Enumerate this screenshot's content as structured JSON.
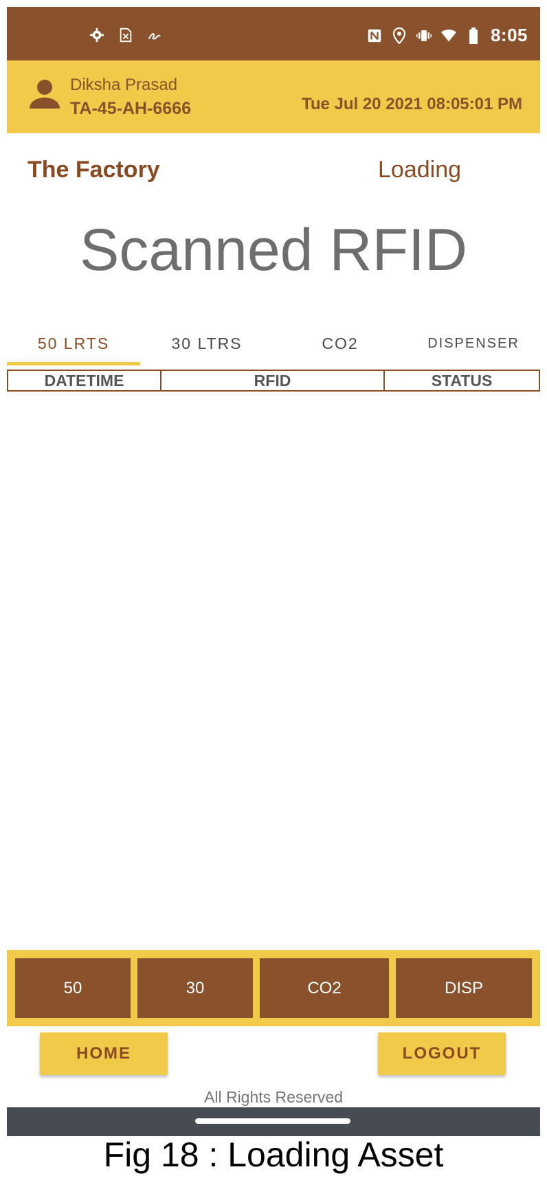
{
  "status_bar": {
    "time": "8:05",
    "left_icons": [
      "settings-icon",
      "sim-card-icon",
      "signature-icon"
    ],
    "right_icons": [
      "nfc-icon",
      "location-icon",
      "vibrate-icon",
      "wifi-icon",
      "battery-icon"
    ]
  },
  "user": {
    "name": "Diksha Prasad",
    "id": "TA-45-AH-6666",
    "datetime": "Tue Jul 20 2021 08:05:01 PM"
  },
  "location": {
    "name": "The Factory",
    "mode": "Loading"
  },
  "heading": "Scanned RFID",
  "tabs": [
    {
      "label": "50 LRTS",
      "active": true
    },
    {
      "label": "30 LTRS",
      "active": false
    },
    {
      "label": "CO2",
      "active": false
    },
    {
      "label": "DISPENSER",
      "active": false
    }
  ],
  "table": {
    "columns": [
      "DATETIME",
      "RFID",
      "STATUS"
    ],
    "rows": []
  },
  "bottom_buttons": [
    "50",
    "30",
    "CO2",
    "DISP"
  ],
  "nav": {
    "home": "HOME",
    "logout": "LOGOUT"
  },
  "footer": "All Rights Reserved",
  "caption": "Fig 18 : Loading Asset",
  "colors": {
    "brown": "#8a522c",
    "yellow": "#f0ca48",
    "navbar": "#474c52"
  }
}
